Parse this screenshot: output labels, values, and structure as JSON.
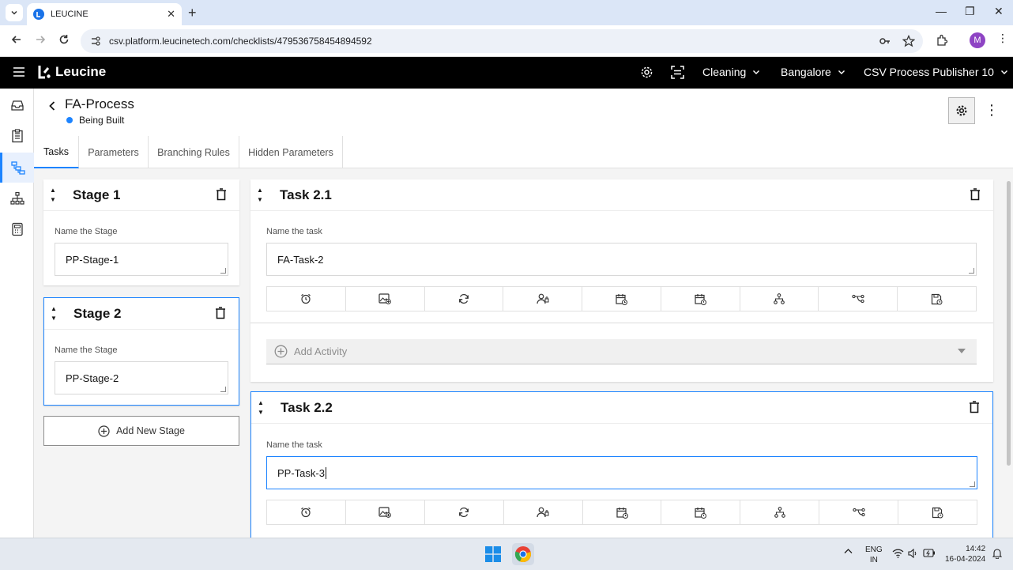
{
  "browser": {
    "tab_title": "LEUCINE",
    "url": "csv.platform.leucinetech.com/checklists/479536758454894592",
    "profile_initial": "M"
  },
  "header": {
    "logo_text": "Leucine",
    "dropdowns": [
      "Cleaning",
      "Bangalore",
      "CSV Process Publisher 10"
    ]
  },
  "rail": {
    "icons": [
      "inbox-icon",
      "checklist-icon",
      "process-flow-icon",
      "hierarchy-icon",
      "calculator-icon"
    ],
    "active_index": 2
  },
  "page": {
    "title": "FA-Process",
    "status": "Being Built",
    "status_color": "#1d84ff"
  },
  "tabs": [
    "Tasks",
    "Parameters",
    "Branching Rules",
    "Hidden Parameters"
  ],
  "stages": [
    {
      "title": "Stage 1",
      "label": "Name the Stage",
      "value": "PP-Stage-1"
    },
    {
      "title": "Stage 2",
      "label": "Name the Stage",
      "value": "PP-Stage-2"
    }
  ],
  "add_stage_label": "Add New Stage",
  "tasks": [
    {
      "title": "Task 2.1",
      "label": "Name the task",
      "value": "FA-Task-2"
    },
    {
      "title": "Task 2.2",
      "label": "Name the task",
      "value": "PP-Task-3"
    }
  ],
  "add_activity_label": "Add Activity",
  "task_tools": [
    "alarm-icon",
    "media-icon",
    "recurrence-icon",
    "assignee-icon",
    "schedule-icon",
    "due-date-icon",
    "branching-icon",
    "interlock-icon",
    "save-icon"
  ],
  "taskbar": {
    "lang_top": "ENG",
    "lang_bottom": "IN",
    "time": "14:42",
    "date": "16-04-2024"
  },
  "colors": {
    "accent": "#1d84ff",
    "header_bg": "#000000"
  }
}
